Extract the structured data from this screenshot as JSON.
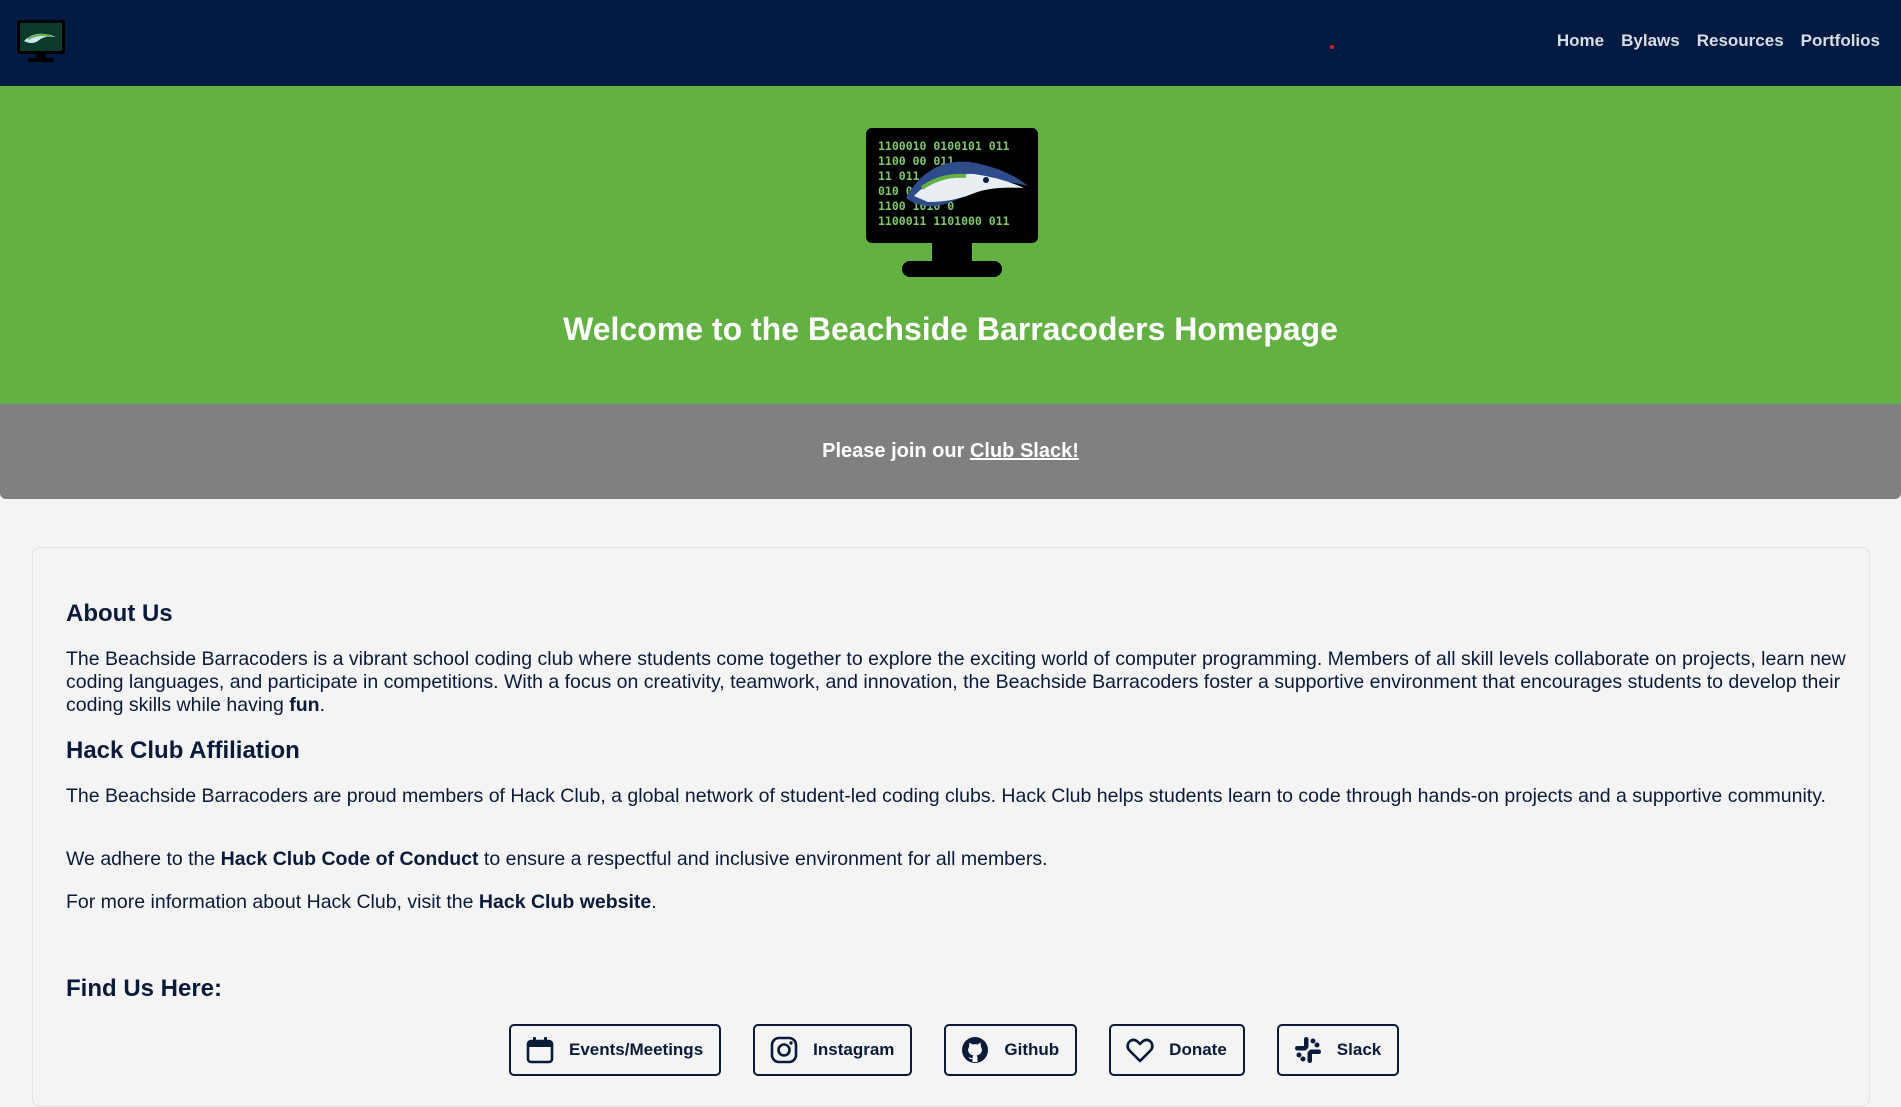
{
  "nav": {
    "links": [
      {
        "label": "Home"
      },
      {
        "label": "Bylaws"
      },
      {
        "label": "Resources"
      },
      {
        "label": "Portfolios"
      }
    ]
  },
  "hero": {
    "title": "Welcome to the Beachside Barracoders Homepage",
    "logo_code_lines": [
      "1100010 0100101 011",
      "1100 00 011",
      "11 011",
      "010 0 011",
      "1100 1010 0",
      "1100011 1101000 011"
    ]
  },
  "banner": {
    "text_before": "Please join our ",
    "link_label": "Club Slack!"
  },
  "about": {
    "heading": "About Us",
    "text_before": "The Beachside Barracoders is a vibrant school coding club where students come together to explore the exciting world of computer programming. Members of all skill levels collaborate on projects, learn new coding languages, and participate in competitions. With a focus on creativity, teamwork, and innovation, the Beachside Barracoders foster a supportive environment that encourages students to develop their coding skills while having ",
    "bold_word": "fun",
    "text_after": "."
  },
  "hackclub": {
    "heading": "Hack Club Affiliation",
    "para1": "The Beachside Barracoders are proud members of Hack Club, a global network of student-led coding clubs. Hack Club helps students learn to code through hands-on projects and a supportive community.",
    "para2_before": "We adhere to the ",
    "para2_link": "Hack Club Code of Conduct",
    "para2_after": " to ensure a respectful and inclusive environment for all members.",
    "para3_before": "For more information about Hack Club, visit the ",
    "para3_link": "Hack Club website",
    "para3_after": "."
  },
  "find_us": {
    "heading": "Find Us Here:",
    "buttons": [
      {
        "label": "Events/Meetings",
        "icon": "calendar-icon"
      },
      {
        "label": "Instagram",
        "icon": "instagram-icon"
      },
      {
        "label": "Github",
        "icon": "github-icon"
      },
      {
        "label": "Donate",
        "icon": "heart-icon"
      },
      {
        "label": "Slack",
        "icon": "slack-icon"
      }
    ]
  },
  "colors": {
    "navbar": "#031a42",
    "hero": "#63b143",
    "banner": "#808080",
    "text": "#0a1a3a",
    "page": "#f4f4f4"
  }
}
